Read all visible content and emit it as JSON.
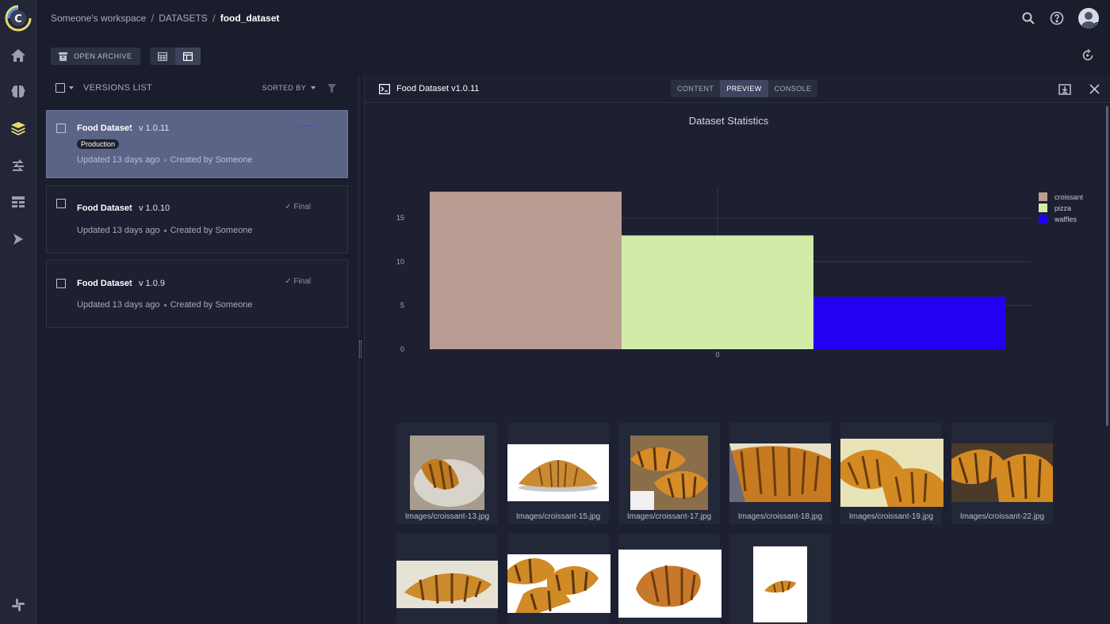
{
  "breadcrumb": {
    "workspace": "Someone's workspace",
    "section": "DATASETS",
    "current": "food_dataset",
    "separator": "/"
  },
  "toolbar": {
    "open_archive_label": "OPEN ARCHIVE"
  },
  "versions_list": {
    "title": "VERSIONS LIST",
    "sorted_by_label": "SORTED BY",
    "items": [
      {
        "name": "Food Dataset",
        "version": "v 1.0.11",
        "tag": "Production",
        "updated": "Updated 13 days ago",
        "created_by": "Created by Someone",
        "status": "",
        "selected": true
      },
      {
        "name": "Food Dataset",
        "version": "v 1.0.10",
        "tag": "",
        "updated": "Updated 13 days ago",
        "created_by": "Created by Someone",
        "status": "✓ Final",
        "selected": false
      },
      {
        "name": "Food Dataset",
        "version": "v 1.0.9",
        "tag": "",
        "updated": "Updated 13 days ago",
        "created_by": "Created by Someone",
        "status": "✓ Final",
        "selected": false
      }
    ]
  },
  "detail_panel": {
    "title": "Food Dataset v1.0.11",
    "tabs": [
      {
        "label": "CONTENT",
        "active": false
      },
      {
        "label": "PREVIEW",
        "active": true
      },
      {
        "label": "CONSOLE",
        "active": false
      }
    ]
  },
  "chart_data": {
    "type": "bar",
    "title": "Dataset Statistics",
    "categories": [
      "0"
    ],
    "series": [
      {
        "name": "croissant",
        "values": [
          18
        ],
        "color": "#b99c92"
      },
      {
        "name": "pizza",
        "values": [
          13
        ],
        "color": "#d2eca8"
      },
      {
        "name": "waffles",
        "values": [
          6
        ],
        "color": "#2200f0"
      }
    ],
    "yticks": [
      "0",
      "5",
      "10",
      "15"
    ],
    "xlabel": "",
    "ylabel": "",
    "ylim": [
      0,
      19
    ],
    "grid": true,
    "legend": "top-right"
  },
  "gallery": {
    "items": [
      {
        "label": "Images/croissant-13.jpg"
      },
      {
        "label": "Images/croissant-15.jpg"
      },
      {
        "label": "Images/croissant-17.jpg"
      },
      {
        "label": "Images/croissant-18.jpg"
      },
      {
        "label": "Images/croissant-19.jpg"
      },
      {
        "label": "Images/croissant-22.jpg"
      },
      {
        "label": ""
      },
      {
        "label": ""
      },
      {
        "label": ""
      },
      {
        "label": ""
      }
    ]
  },
  "colors": {
    "background": "#1a1e2c",
    "selected_card": "#5b6486",
    "accent_yellow": "#e6d870"
  }
}
